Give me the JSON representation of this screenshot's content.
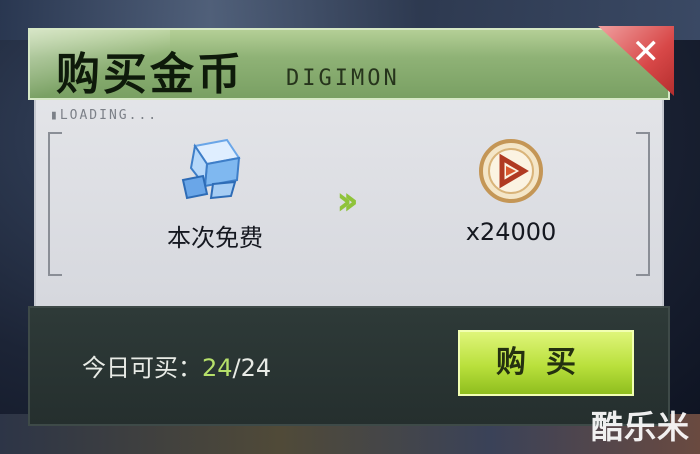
{
  "dialog": {
    "title": "购买金币",
    "subtitle": "DIGIMON",
    "loading_text": "▮LOADING...",
    "exchange": {
      "cost_icon": "blue-crystal-icon",
      "cost_label": "本次免费",
      "arrow_icon": "double-chevron-right-icon",
      "reward_icon": "gold-coin-icon",
      "reward_label": "x24000"
    },
    "quota": {
      "label": "今日可买：",
      "current": "24",
      "separator": "/",
      "max": "24"
    },
    "buy_button_label": "购买",
    "close_icon": "close-icon"
  },
  "watermark": "酷乐米",
  "colors": {
    "header_green": "#8fb276",
    "accent_lime": "#b9e03c",
    "close_red": "#d84848",
    "quota_highlight": "#b6e06a"
  }
}
